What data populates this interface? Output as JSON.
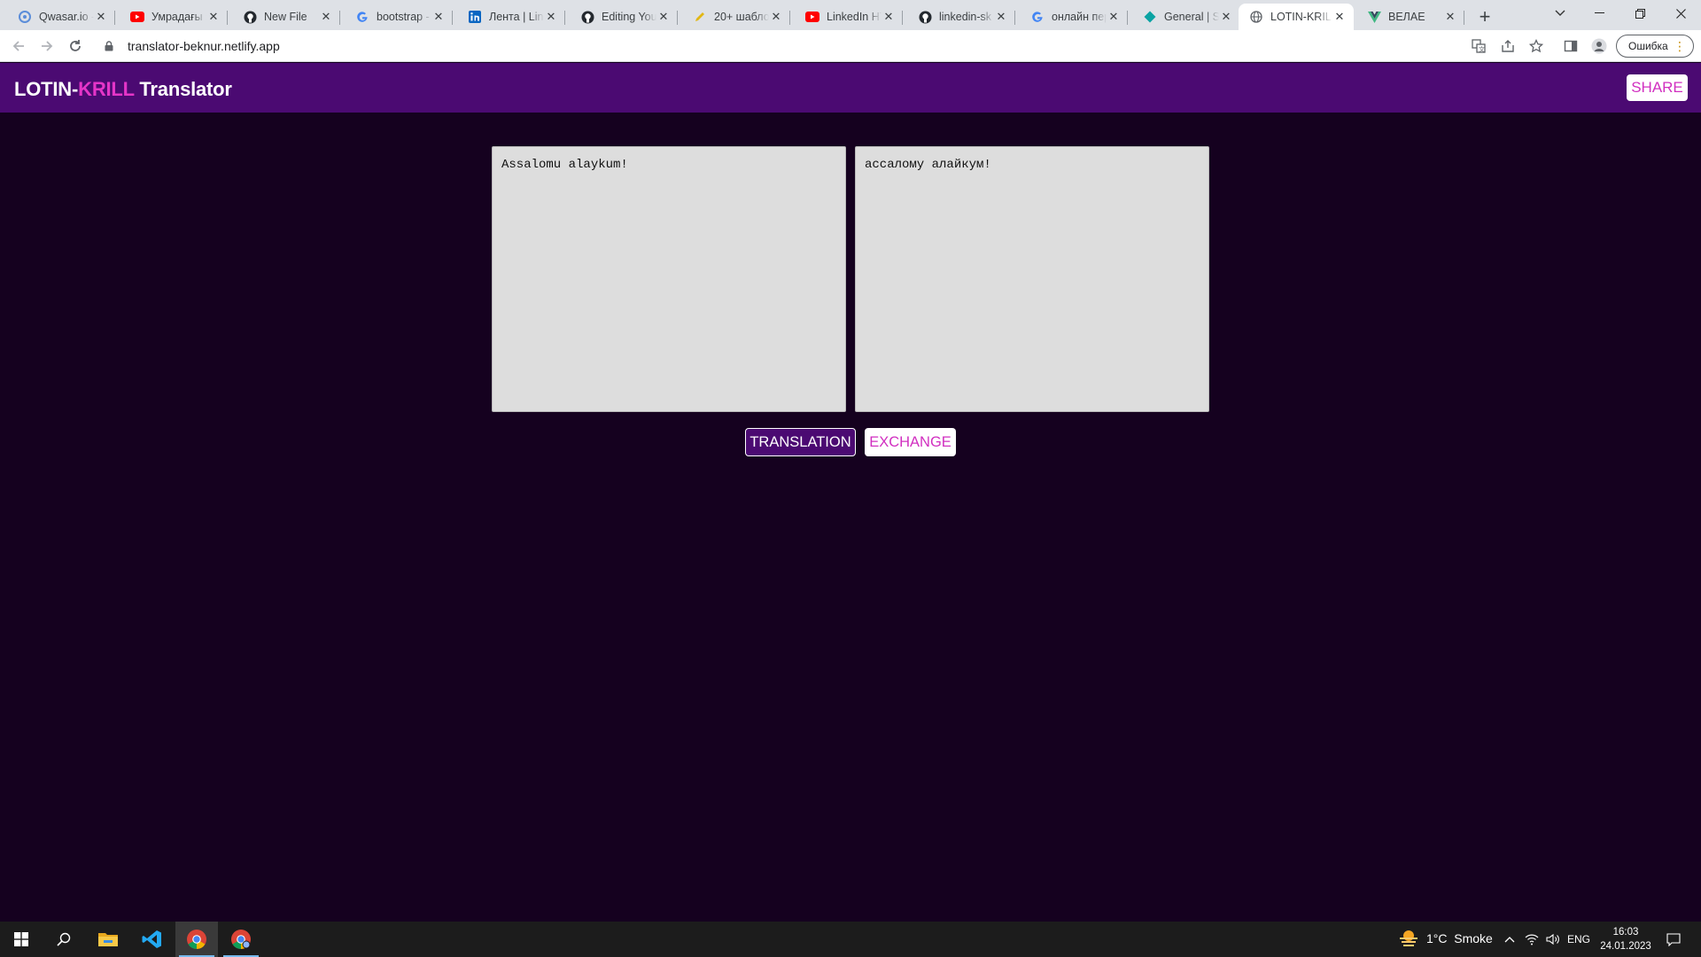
{
  "browser": {
    "tabs": [
      {
        "title": "Qwasar.io -",
        "favicon": "qwasar-icon",
        "color": "#5b8dd9"
      },
      {
        "title": "Умрадағы э",
        "favicon": "youtube-icon",
        "color": "#ff0000"
      },
      {
        "title": "New File",
        "favicon": "github-icon",
        "color": "#24292f"
      },
      {
        "title": "bootstrap -",
        "favicon": "google-icon",
        "color": "#4285f4"
      },
      {
        "title": "Лента | Link",
        "favicon": "linkedin-icon",
        "color": "#0a66c2"
      },
      {
        "title": "Editing You",
        "favicon": "github-icon",
        "color": "#24292f"
      },
      {
        "title": "20+ шабло",
        "favicon": "pencil-icon",
        "color": "#e2b714"
      },
      {
        "title": "LinkedIn HT",
        "favicon": "youtube-icon",
        "color": "#ff0000"
      },
      {
        "title": "linkedin-sk",
        "favicon": "github-icon",
        "color": "#24292f"
      },
      {
        "title": "онлайн пер",
        "favicon": "google-icon",
        "color": "#4285f4"
      },
      {
        "title": "General | Sl",
        "favicon": "diamond-icon",
        "color": "#0aa3a3"
      },
      {
        "title": "LOTIN-KRIL",
        "favicon": "globe-icon",
        "color": "#5f6368",
        "active": true
      },
      {
        "title": "ВЕЛАЕ",
        "favicon": "vue-icon",
        "color": "#41b883"
      }
    ],
    "url": "translator-beknur.netlify.app",
    "profile_status": "Ошибка"
  },
  "app": {
    "brand_part1": "LOTIN-",
    "brand_accent": "KRILL",
    "brand_part2": " Translator",
    "share_label": "SHARE",
    "source_text": "Assalomu alaykum!",
    "target_text": "ассалому алайкум!",
    "translate_label": "TRANSLATION",
    "exchange_label": "EXCHANGE",
    "colors": {
      "header": "#4b0a72",
      "background": "#15011f",
      "accent": "#e535c8"
    }
  },
  "taskbar": {
    "weather": "1°C  Smoke",
    "language": "ENG",
    "time": "16:03",
    "date": "24.01.2023"
  }
}
